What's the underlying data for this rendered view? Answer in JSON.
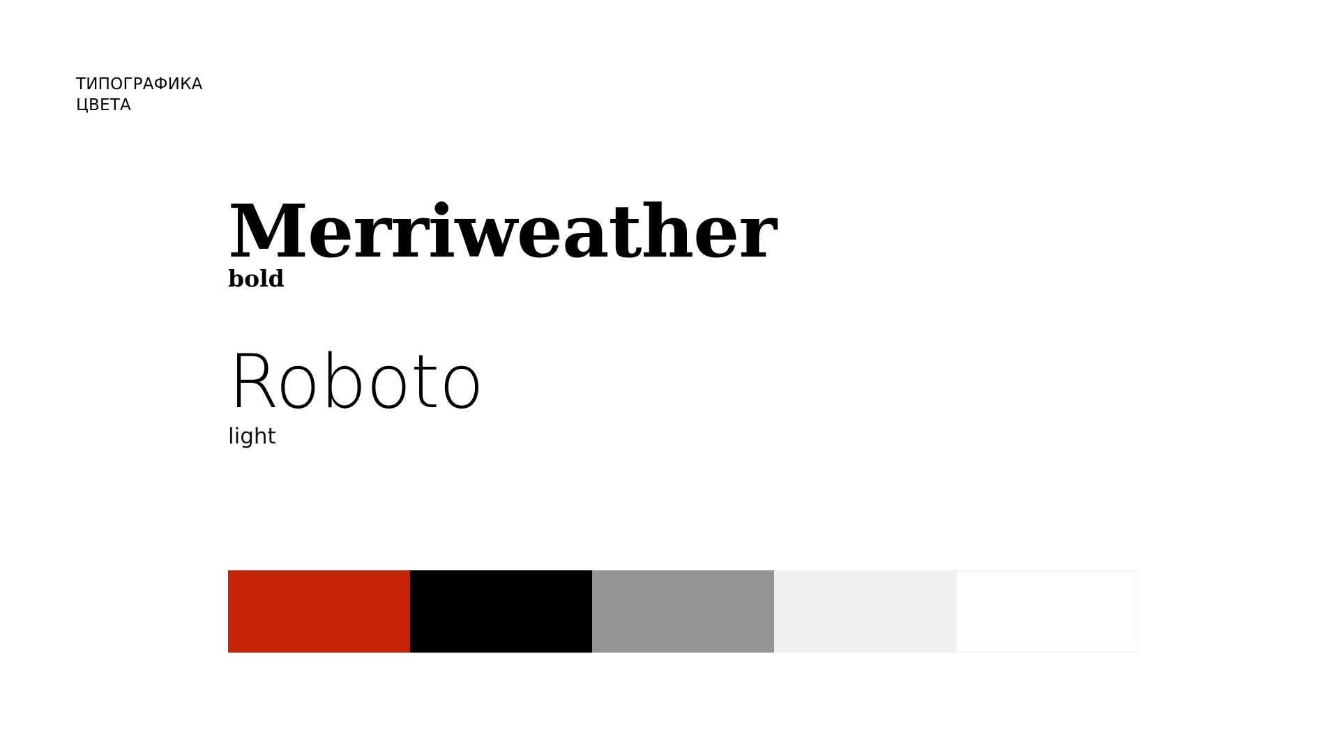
{
  "nav": {
    "items": [
      {
        "label": "ТИПОГРАФИКА"
      },
      {
        "label": "ЦВЕТА"
      }
    ]
  },
  "fonts": {
    "primary": {
      "name": "Merriweather",
      "weight": "bold"
    },
    "secondary": {
      "name": "Roboto",
      "weight": "light"
    }
  },
  "palette": {
    "swatches": [
      {
        "color": "#c52303"
      },
      {
        "color": "#000000"
      },
      {
        "color": "#959595"
      },
      {
        "color": "#f0f0f0"
      },
      {
        "color": "#ffffff"
      }
    ]
  }
}
